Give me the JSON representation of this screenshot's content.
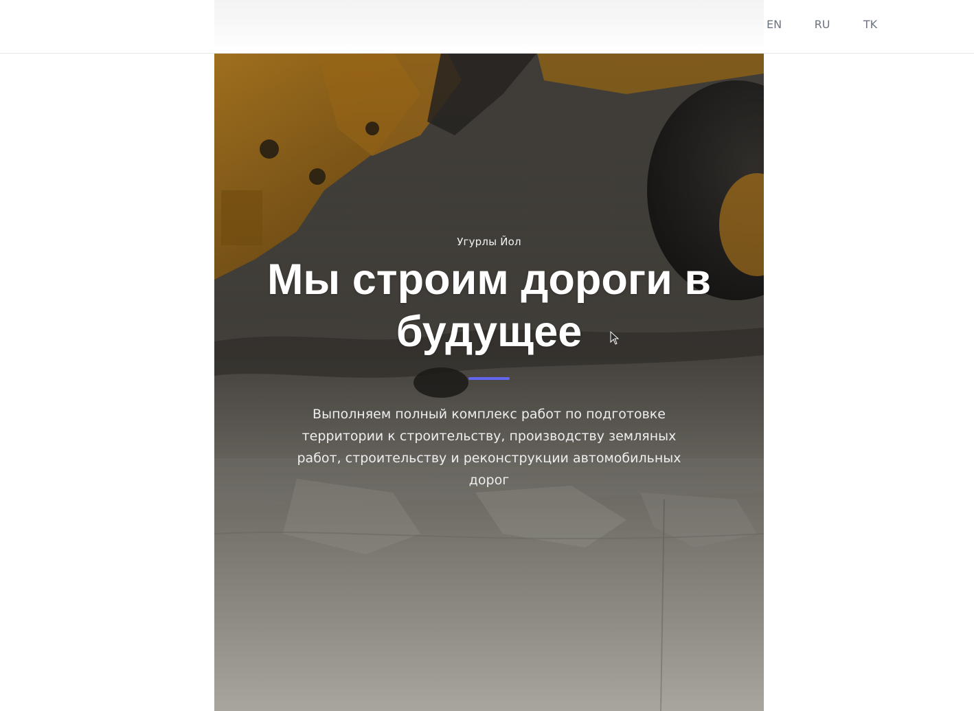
{
  "header": {
    "languages": [
      {
        "code": "EN"
      },
      {
        "code": "RU"
      },
      {
        "code": "TK"
      }
    ]
  },
  "hero": {
    "eyebrow": "Угурлы Йол",
    "headline": "Мы строим дороги в будущее",
    "description": "Выполняем полный комплекс работ по подготовке территории к строительству, производству земляных работ, строительству и реконструкции автомобильных дорог",
    "accent_color": "#6366f1"
  }
}
